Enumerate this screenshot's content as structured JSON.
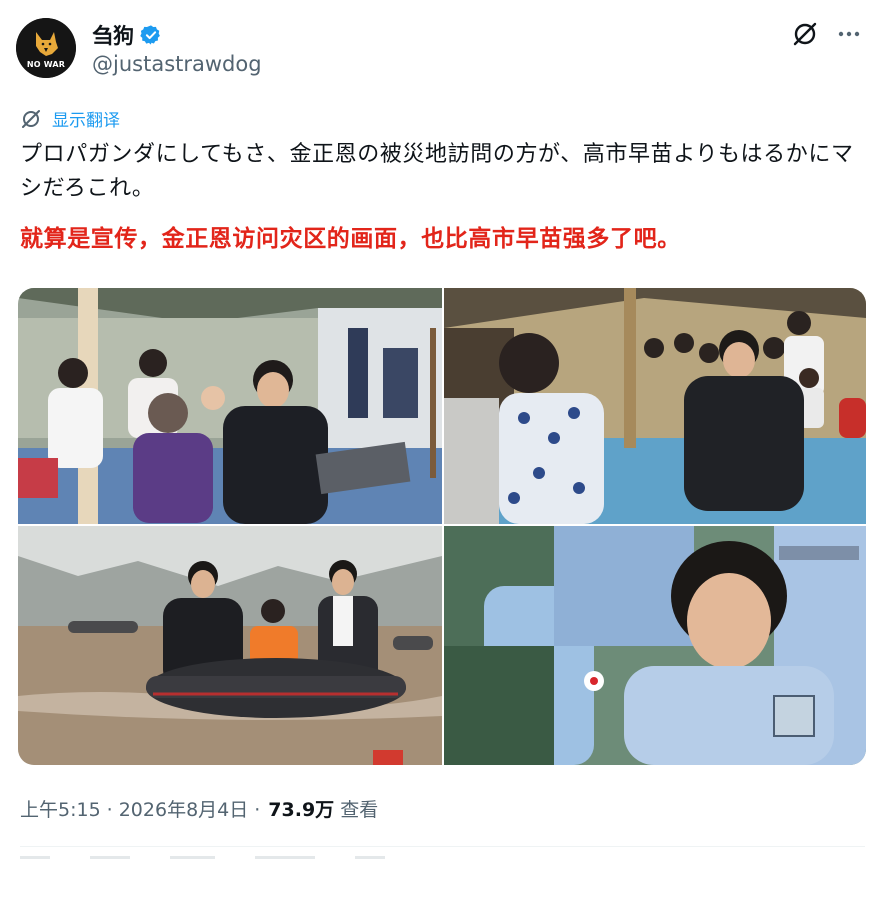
{
  "header": {
    "display_name": "刍狗",
    "handle": "@justastrawdog",
    "avatar_text": "NO WAR",
    "verified": true,
    "icons": [
      "grok-icon",
      "more-icon"
    ]
  },
  "translate": {
    "label": "显示翻译",
    "icon": "grok-icon"
  },
  "tweet": {
    "text_ja": "プロパガンダにしてもさ、金正恩の被災地訪問の方が、高市早苗よりもはるかにマシだろこれ。",
    "text_cn": "就算是宣传，金正恩访问灾区的画面，也比高市早苗强多了吧。"
  },
  "media": {
    "photos": [
      "tent-visit-photo",
      "tent-meeting-photo",
      "flood-boat-photo",
      "japanese-official-photo"
    ]
  },
  "meta": {
    "time": "上午5:15",
    "date": "2026年8月4日",
    "views_count": "73.9万",
    "views_label": "查看",
    "separator": "·"
  },
  "colors": {
    "accent": "#1d9bf0",
    "highlight_red": "#e2251a",
    "text_primary": "#0f1419",
    "text_secondary": "#536471"
  }
}
